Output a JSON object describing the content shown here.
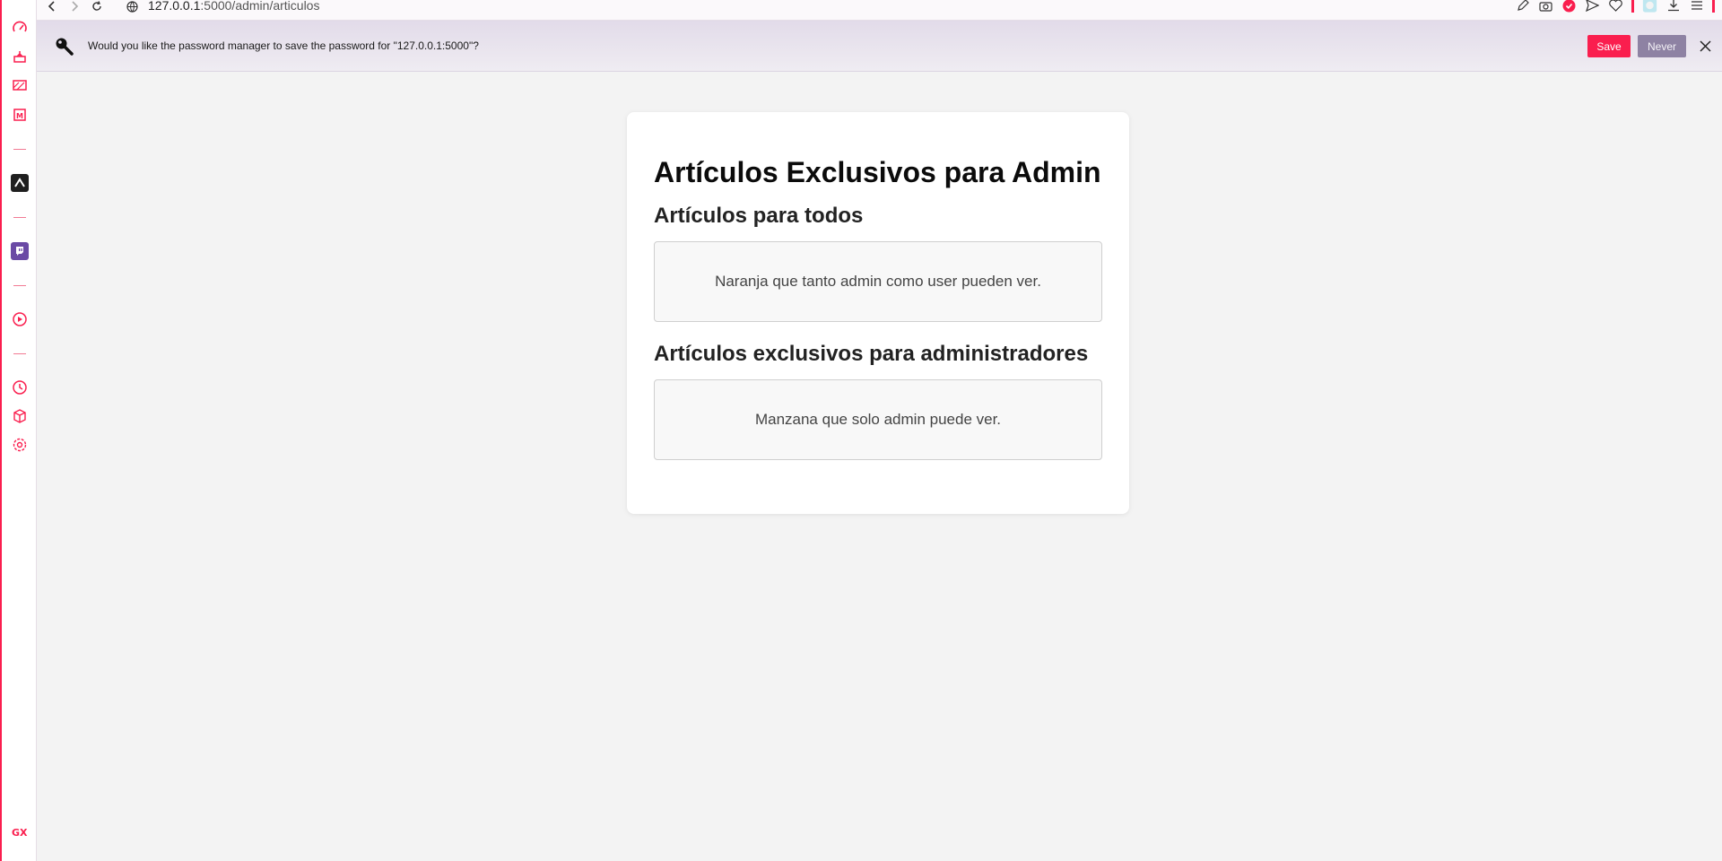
{
  "browser": {
    "url_host": "127.0.0.1",
    "url_rest": ":5000/admin/articulos",
    "accent_color": "#fa1e4e"
  },
  "sidebar": {
    "items": [
      {
        "icon": "speed-dial-icon"
      },
      {
        "icon": "gx-cleaner-icon"
      },
      {
        "icon": "gx-corner-icon"
      },
      {
        "icon": "gx-mods-icon"
      },
      {
        "icon": "app-icon"
      },
      {
        "icon": "twitch-icon"
      },
      {
        "icon": "player-icon"
      },
      {
        "icon": "history-icon"
      },
      {
        "icon": "extensions-icon"
      },
      {
        "icon": "settings-icon"
      }
    ],
    "footer_label": "GX"
  },
  "infobar": {
    "message": "Would you like the password manager to save the password for \"127.0.0.1:5000\"?",
    "save_label": "Save",
    "never_label": "Never"
  },
  "page": {
    "title": "Artículos Exclusivos para Admin",
    "sections": [
      {
        "heading": "Artículos para todos",
        "article": "Naranja que tanto admin como user pueden ver."
      },
      {
        "heading": "Artículos exclusivos para administradores",
        "article": "Manzana que solo admin puede ver."
      }
    ]
  }
}
